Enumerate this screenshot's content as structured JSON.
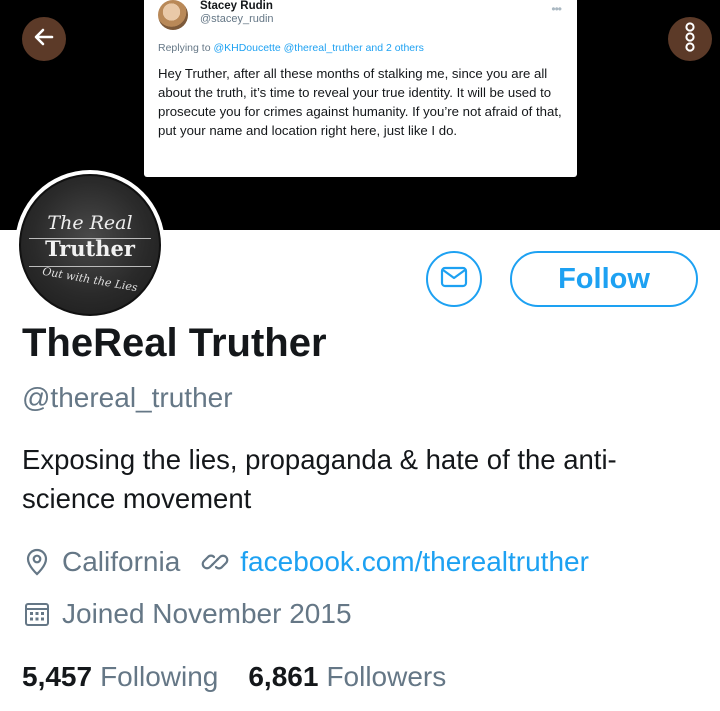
{
  "banner": {
    "tweet": {
      "author_name": "Stacey Rudin",
      "author_handle": "@stacey_rudin",
      "more_glyph": "•••",
      "reply_prefix": "Replying to ",
      "reply_mentions": "@KHDoucette @thereal_truther",
      "reply_suffix": " and 2 others",
      "body": "Hey Truther, after all these months of stalking me, since you are all about the truth, it’s time to reveal your true identity. It will be used to prosecute you for crimes against humanity. If you’re not afraid of that, put your name and location right here, just like I do."
    }
  },
  "avatar": {
    "line1": "The Real",
    "line2": "Truther",
    "line3": "Out with the Lies"
  },
  "actions": {
    "follow_label": "Follow"
  },
  "profile": {
    "display_name": "TheReal Truther",
    "handle": "@thereal_truther",
    "bio": "Exposing the lies, propaganda & hate of the anti-science movement",
    "location": "California",
    "website": "facebook.com/therealtruther",
    "joined": "Joined November 2015",
    "following_count": "5,457",
    "following_label": "Following",
    "followers_count": "6,861",
    "followers_label": "Followers"
  },
  "colors": {
    "accent": "#1da1f2",
    "banner_button": "#5c3a28",
    "secondary_text": "#657786"
  },
  "icons": [
    "back-arrow-icon",
    "more-options-icon",
    "message-icon",
    "location-pin-icon",
    "link-icon",
    "calendar-icon"
  ]
}
